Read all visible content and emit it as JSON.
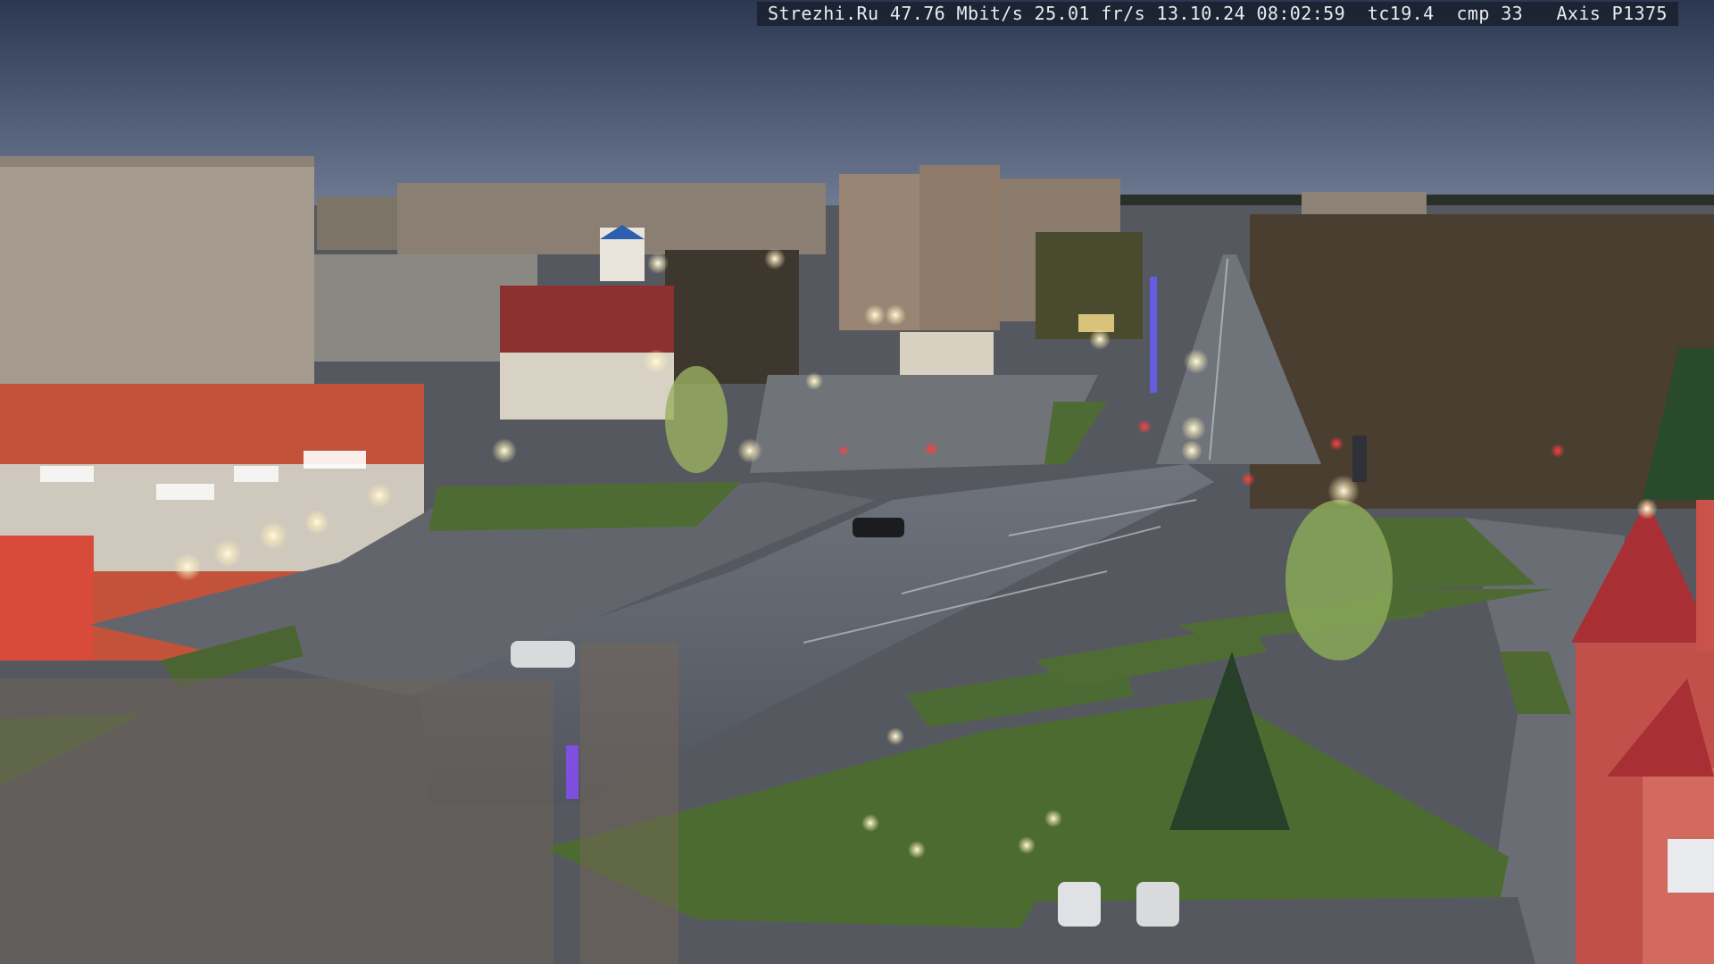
{
  "camera_overlay": {
    "site": "Strezhi.Ru",
    "bitrate": "47.76 Mbit/s",
    "framerate": "25.01 fr/s",
    "date": "13.10.24",
    "time": "08:02:59",
    "tc": "tc19.4",
    "cmp": "cmp 33",
    "camera_model": "Axis P1375"
  },
  "colors": {
    "sky_top": "#2e3a55",
    "sky_horizon": "#6c7890",
    "road": "#5a5f6a",
    "grass": "#4c6a34",
    "building_red": "#b83a3a",
    "streetlight": "#fff6d8",
    "traffic_light_red": "#ff3030"
  }
}
